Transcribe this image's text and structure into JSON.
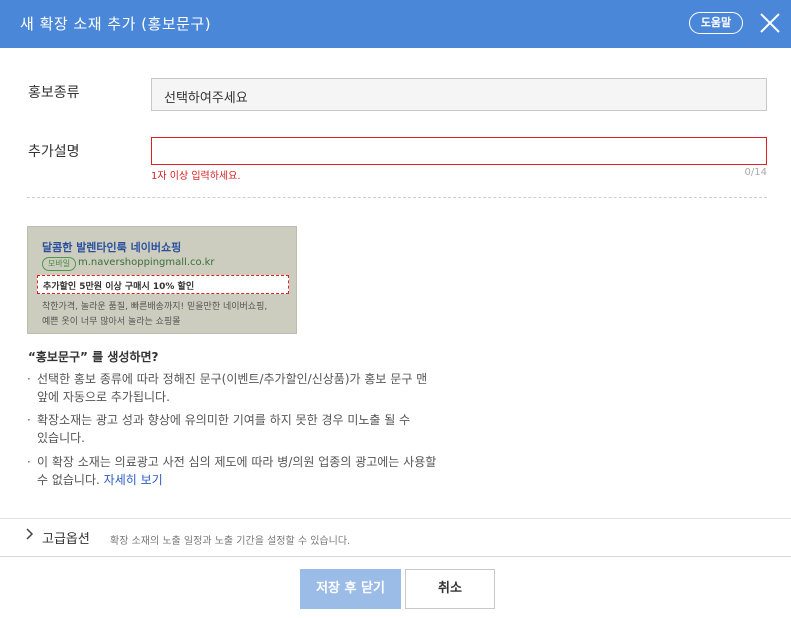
{
  "header": {
    "title": "새 확장 소재 추가 (홍보문구)",
    "help_label": "도움말",
    "close_icon": "close-icon",
    "color": "#4a87d8"
  },
  "form": {
    "promo_type": {
      "label": "홍보종류",
      "value": "선택하여주세요"
    },
    "add_desc": {
      "label": "추가설명",
      "value": "",
      "error": "1자 이상 입력하세요.",
      "counter": "0/14"
    }
  },
  "preview": {
    "title": "달콤한 발렌타인룩 네이버쇼핑",
    "badge": "모바일",
    "url": "m.navershoppingmall.co.kr",
    "promo": "추가할인 5만원 이상 구매시 10% 할인",
    "desc_line1": "착한가격, 놀라운 품질, 빠른배송까지! 믿을만한 네이버쇼핑,",
    "desc_line2": "예쁜 옷이 너무 많아서 놀라는 쇼핑몰"
  },
  "info": {
    "heading": "“홍보문구” 를 생성하면?",
    "bullet1_line1": "선택한 홍보 종류에 따라 정해진 문구(이벤트/추가할인/신상품)가 홍보 문구 맨",
    "bullet1_line2": "앞에 자동으로 추가됩니다.",
    "bullet2_line1": "확장소재는 광고 성과 향상에 유의미한 기여를 하지 못한 경우 미노출 될 수",
    "bullet2_line2": "있습니다.",
    "bullet3_line1": "이 확장 소재는 의료광고 사전 심의 제도에 따라 병/의원 업종의 광고에는 사용할",
    "bullet3_line2": "수 없습니다.",
    "detail_link": "자세히 보기"
  },
  "advanced": {
    "chevron_icon": "chevron-right-icon",
    "label": "고급옵션",
    "desc": "확장 소재의 노출 일정과 노출 기간을 설정할 수 있습니다."
  },
  "footer": {
    "save_label": "저장 후 닫기",
    "cancel_label": "취소"
  }
}
